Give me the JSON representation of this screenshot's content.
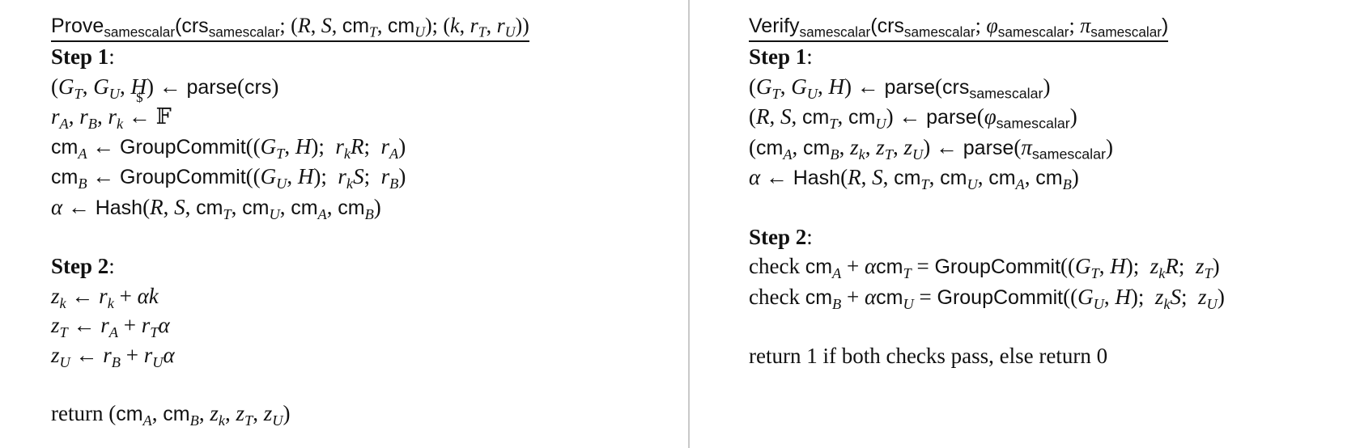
{
  "prove": {
    "title": {
      "name": "Prove",
      "sub": "samescalar",
      "open": "(",
      "crs": "crs",
      "crs_sub": "samescalar",
      "sep1": "; ",
      "stmt_open": "(",
      "R": "R",
      "c1": ", ",
      "S": "S",
      "c2": ", ",
      "cm1": "cm",
      "cm1_sub": "T",
      "c3": ", ",
      "cm2": "cm",
      "cm2_sub": "U",
      "stmt_close": ")",
      "sep2": "; ",
      "wit_open": "(",
      "k": "k",
      "c4": ", ",
      "r1": "r",
      "r1_sub": "T",
      "c5": ", ",
      "r2": "r",
      "r2_sub": "U",
      "wit_close": ")",
      "close": ")"
    },
    "step1": {
      "label": "Step 1",
      "colon": ":"
    },
    "s1l1": {
      "open": "(",
      "G1": "G",
      "G1s": "T",
      "c1": ", ",
      "G2": "G",
      "G2s": "U",
      "c2": ", ",
      "H": "H",
      "close": ")",
      "arrow": " ← ",
      "fn": "parse",
      "fopen": "(",
      "arg": "crs",
      "fclose": ")"
    },
    "s1l2": {
      "r1": "r",
      "r1s": "A",
      "c1": ", ",
      "r2": "r",
      "r2s": "B",
      "c2": ", ",
      "r3": "r",
      "r3s": "k",
      "dollar": "$",
      "arrow": "←",
      "field": "𝔽"
    },
    "s1l3": {
      "cm": "cm",
      "cms": "A",
      "arrow": " ← ",
      "fn": "GroupCommit",
      "open": "((",
      "G": "G",
      "Gs": "T",
      "c": ", ",
      "H": "H",
      "close1": ");",
      "r": "r",
      "rs": "k",
      "P": "R",
      "semi": ";",
      "ra": "r",
      "ras": "A",
      "close2": ")"
    },
    "s1l4": {
      "cm": "cm",
      "cms": "B",
      "arrow": " ← ",
      "fn": "GroupCommit",
      "open": "((",
      "G": "G",
      "Gs": "U",
      "c": ", ",
      "H": "H",
      "close1": ");",
      "r": "r",
      "rs": "k",
      "P": "S",
      "semi": ";",
      "ra": "r",
      "ras": "B",
      "close2": ")"
    },
    "s1l5": {
      "alpha": "α",
      "arrow": " ← ",
      "fn": "Hash",
      "open": "(",
      "R": "R",
      "c1": ", ",
      "S": "S",
      "c2": ", ",
      "cm1": "cm",
      "cm1s": "T",
      "c3": ", ",
      "cm2": "cm",
      "cm2s": "U",
      "c4": ", ",
      "cm3": "cm",
      "cm3s": "A",
      "c5": ", ",
      "cm4": "cm",
      "cm4s": "B",
      "close": ")"
    },
    "step2": {
      "label": "Step 2",
      "colon": ":"
    },
    "s2l1": {
      "z": "z",
      "zs": "k",
      "arrow": " ← ",
      "r": "r",
      "rs": "k",
      "plus": " + ",
      "a": "αk"
    },
    "s2l2": {
      "z": "z",
      "zs": "T",
      "arrow": " ← ",
      "r": "r",
      "rs": "A",
      "plus": " + ",
      "r2": "r",
      "r2s": "T",
      "a": "α"
    },
    "s2l3": {
      "z": "z",
      "zs": "U",
      "arrow": " ← ",
      "r": "r",
      "rs": "B",
      "plus": " + ",
      "r2": "r",
      "r2s": "U",
      "a": "α"
    },
    "ret": {
      "word": "return ",
      "open": "(",
      "cm1": "cm",
      "cm1s": "A",
      "c1": ", ",
      "cm2": "cm",
      "cm2s": "B",
      "c2": ", ",
      "z1": "z",
      "z1s": "k",
      "c3": ", ",
      "z2": "z",
      "z2s": "T",
      "c4": ", ",
      "z3": "z",
      "z3s": "U",
      "close": ")"
    }
  },
  "verify": {
    "title": {
      "name": "Verify",
      "sub": "samescalar",
      "open": "(",
      "crs": "crs",
      "crs_sub": "samescalar",
      "sep1": "; ",
      "phi": "φ",
      "phi_sub": "samescalar",
      "sep2": "; ",
      "pi": "π",
      "pi_sub": "samescalar",
      "close": ")"
    },
    "step1": {
      "label": "Step 1",
      "colon": ":"
    },
    "s1l1": {
      "open": "(",
      "G1": "G",
      "G1s": "T",
      "c1": ", ",
      "G2": "G",
      "G2s": "U",
      "c2": ", ",
      "H": "H",
      "close": ")",
      "arrow": " ← ",
      "fn": "parse",
      "fopen": "(",
      "arg": "crs",
      "args": "samescalar",
      "fclose": ")"
    },
    "s1l2": {
      "open": "(",
      "R": "R",
      "c1": ", ",
      "S": "S",
      "c2": ", ",
      "cm1": "cm",
      "cm1s": "T",
      "c3": ", ",
      "cm2": "cm",
      "cm2s": "U",
      "close": ")",
      "arrow": " ← ",
      "fn": "parse",
      "fopen": "(",
      "arg": "φ",
      "args": "samescalar",
      "fclose": ")"
    },
    "s1l3": {
      "open": "(",
      "cm1": "cm",
      "cm1s": "A",
      "c1": ", ",
      "cm2": "cm",
      "cm2s": "B",
      "c2": ", ",
      "z1": "z",
      "z1s": "k",
      "c3": ", ",
      "z2": "z",
      "z2s": "T",
      "c4": ", ",
      "z3": "z",
      "z3s": "U",
      "close": ")",
      "arrow": " ← ",
      "fn": "parse",
      "fopen": "(",
      "arg": "π",
      "args": "samescalar",
      "fclose": ")"
    },
    "s1l4": {
      "alpha": "α",
      "arrow": " ← ",
      "fn": "Hash",
      "open": "(",
      "R": "R",
      "c1": ", ",
      "S": "S",
      "c2": ", ",
      "cm1": "cm",
      "cm1s": "T",
      "c3": ", ",
      "cm2": "cm",
      "cm2s": "U",
      "c4": ", ",
      "cm3": "cm",
      "cm3s": "A",
      "c5": ", ",
      "cm4": "cm",
      "cm4s": "B",
      "close": ")"
    },
    "step2": {
      "label": "Step 2",
      "colon": ":"
    },
    "check1": {
      "word": "check ",
      "cm": "cm",
      "cms": "A",
      "plus": " + ",
      "alpha": "α",
      "cm2": "cm",
      "cm2s": "T",
      "eq": " = ",
      "fn": "GroupCommit",
      "open": "((",
      "G": "G",
      "Gs": "T",
      "c": ", ",
      "H": "H",
      "close1": ");",
      "z": "z",
      "zs": "k",
      "P": "R",
      "semi": ";",
      "z2": "z",
      "z2s": "T",
      "close2": ")"
    },
    "check2": {
      "word": "check ",
      "cm": "cm",
      "cms": "B",
      "plus": " + ",
      "alpha": "α",
      "cm2": "cm",
      "cm2s": "U",
      "eq": " = ",
      "fn": "GroupCommit",
      "open": "((",
      "G": "G",
      "Gs": "U",
      "c": ", ",
      "H": "H",
      "close1": ");",
      "z": "z",
      "zs": "k",
      "P": "S",
      "semi": ";",
      "z2": "z",
      "z2s": "U",
      "close2": ")"
    },
    "ret": {
      "text": "return 1 if both checks pass, else return 0"
    }
  }
}
